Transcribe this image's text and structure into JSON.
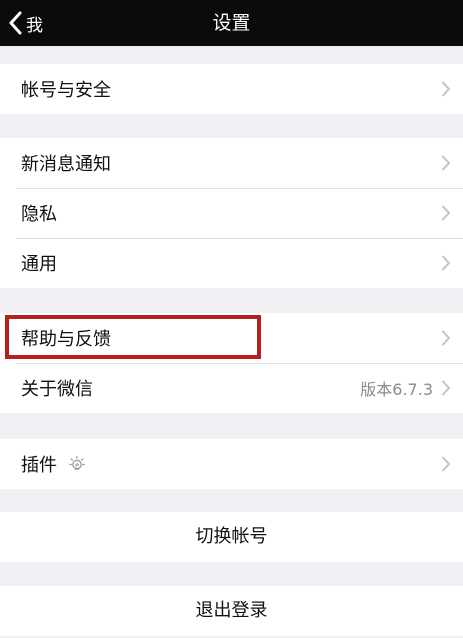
{
  "navbar": {
    "back_label": "我",
    "title": "设置"
  },
  "account": {
    "label": "帐号与安全"
  },
  "notifications": {
    "items": [
      {
        "label": "新消息通知"
      },
      {
        "label": "隐私"
      },
      {
        "label": "通用"
      }
    ]
  },
  "support": {
    "help_label": "帮助与反馈",
    "about_label": "关于微信",
    "version": "版本6.7.3"
  },
  "plugins": {
    "label": "插件",
    "icon": "lightbulb-icon"
  },
  "switch_account": {
    "label": "切换帐号"
  },
  "logout": {
    "label": "退出登录"
  },
  "colors": {
    "navbar_bg": "#0b0b0b",
    "page_bg": "#efeff4",
    "highlight_border": "#b2201f"
  }
}
